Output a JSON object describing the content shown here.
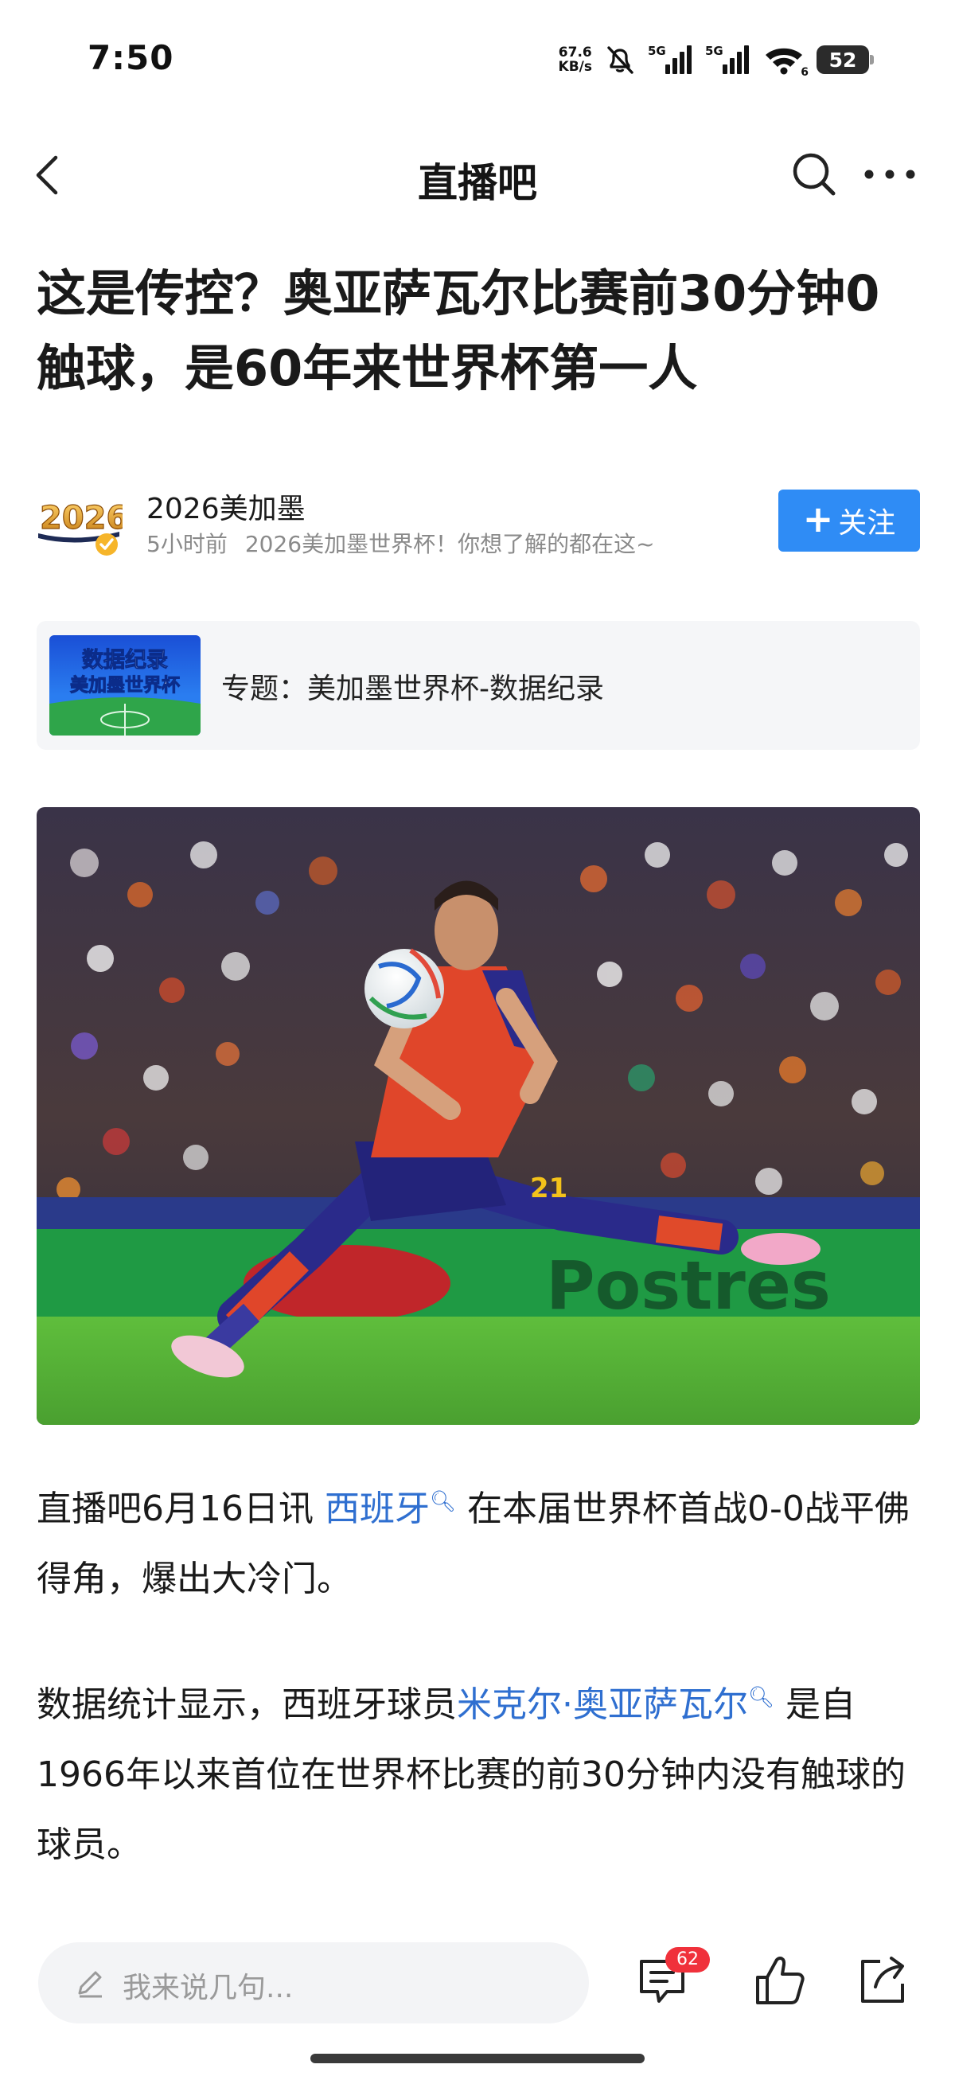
{
  "status_bar": {
    "time": "7:50",
    "net_speed_value": "67.6",
    "net_speed_unit": "KB/s",
    "sim1_tag": "5G",
    "sim2_tag": "5G",
    "wifi_tag": "6",
    "battery": "52"
  },
  "nav": {
    "title": "直播吧",
    "icons": [
      "back-icon",
      "search-icon",
      "more-icon"
    ]
  },
  "article": {
    "title": "这是传控？奥亚萨瓦尔比赛前30分钟0触球，是60年来世界杯第一人",
    "author": {
      "name": "2026美加墨",
      "avatar_text": "2026",
      "time_ago": "5小时前",
      "description": "2026美加墨世界杯！你想了解的都在这~",
      "follow_label": "关注"
    },
    "topic": {
      "thumb_line1": "数据纪录",
      "thumb_line2": "美加墨世界杯",
      "label": "专题：美加墨世界杯-数据纪录"
    },
    "hero_image": {
      "board_text": "Postres",
      "jersey_number": "21"
    },
    "para1": {
      "before": "直播吧6月16日讯 ",
      "link": "西班牙",
      "after": " 在本届世界杯首战0-0战平佛得角，爆出大冷门。"
    },
    "para2": {
      "before": "数据统计显示，西班牙球员",
      "link": "米克尔·奥亚萨瓦尔",
      "after": " 是自1966年以来首位在世界杯比赛的前30分钟内没有触球的球员。"
    }
  },
  "bottom_bar": {
    "comment_placeholder": "我来说几句...",
    "comment_count": "62",
    "icons": [
      "pencil-icon",
      "comment-icon",
      "like-icon",
      "share-icon"
    ]
  },
  "colors": {
    "accent": "#2f8cf5",
    "link": "#2f6fd0",
    "badge": "#f0313b",
    "meta_text": "#8a8a8a"
  }
}
